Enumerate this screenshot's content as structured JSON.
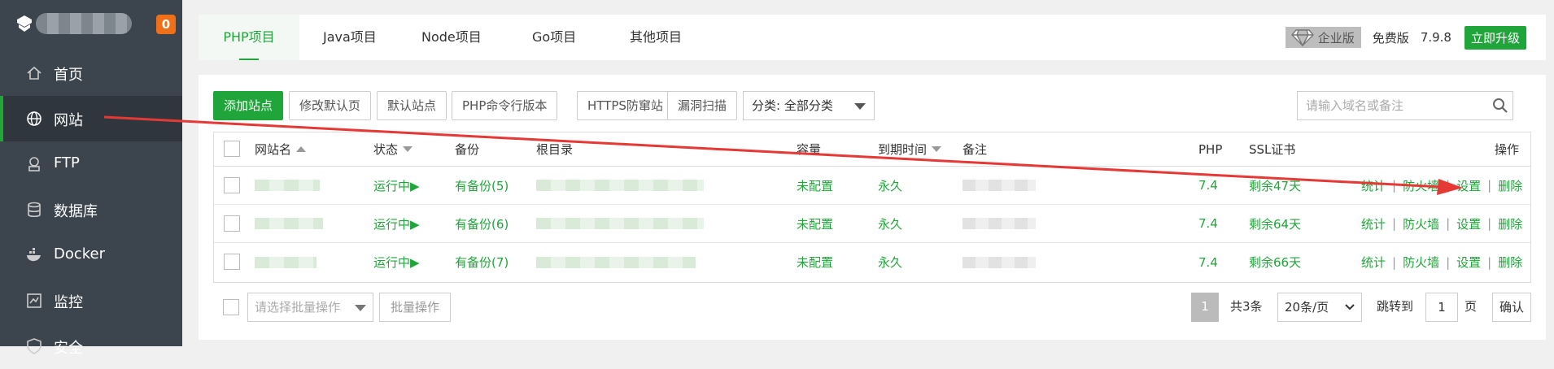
{
  "sidebar": {
    "notification_count": "0",
    "items": [
      {
        "label": "首页",
        "icon": "home-icon"
      },
      {
        "label": "网站",
        "icon": "globe-icon"
      },
      {
        "label": "FTP",
        "icon": "ftp-icon"
      },
      {
        "label": "数据库",
        "icon": "database-icon"
      },
      {
        "label": "Docker",
        "icon": "docker-icon"
      },
      {
        "label": "监控",
        "icon": "monitor-icon"
      },
      {
        "label": "安全",
        "icon": "shield-icon"
      }
    ]
  },
  "topbar": {
    "tabs": [
      "PHP项目",
      "Java项目",
      "Node项目",
      "Go项目",
      "其他项目"
    ],
    "enterprise_label": "企业版",
    "edition": "免费版",
    "version": "7.9.8",
    "upgrade_label": "立即升级"
  },
  "toolbar": {
    "buttons": [
      "添加站点",
      "修改默认页",
      "默认站点",
      "PHP命令行版本",
      "HTTPS防窜站",
      "漏洞扫描"
    ],
    "category": "分类: 全部分类",
    "search_placeholder": "请输入域名或备注"
  },
  "table": {
    "headers": [
      "网站名",
      "状态",
      "备份",
      "根目录",
      "容量",
      "到期时间",
      "备注",
      "PHP",
      "SSL证书",
      "操作"
    ],
    "rows": [
      {
        "status": "运行中▶",
        "backup": "有备份(5)",
        "capacity": "未配置",
        "expiry": "永久",
        "php": "7.4",
        "ssl": "剩余47天"
      },
      {
        "status": "运行中▶",
        "backup": "有备份(6)",
        "capacity": "未配置",
        "expiry": "永久",
        "php": "7.4",
        "ssl": "剩余64天"
      },
      {
        "status": "运行中▶",
        "backup": "有备份(7)",
        "capacity": "未配置",
        "expiry": "永久",
        "php": "7.4",
        "ssl": "剩余66天"
      }
    ],
    "actions": [
      "统计",
      "防火墙",
      "设置",
      "删除"
    ],
    "action_separator": "|"
  },
  "footer": {
    "batch_placeholder": "请选择批量操作",
    "batch_button": "批量操作",
    "current_page": "1",
    "total": "共3条",
    "per_page": "20条/页",
    "jump_label": "跳转到",
    "jump_value": "1",
    "page_unit": "页",
    "confirm": "确认"
  },
  "colors": {
    "accent": "#20a53a",
    "sidebar_bg": "#3c444d",
    "badge": "#f0701a",
    "annotation_arrow": "#e53935"
  }
}
